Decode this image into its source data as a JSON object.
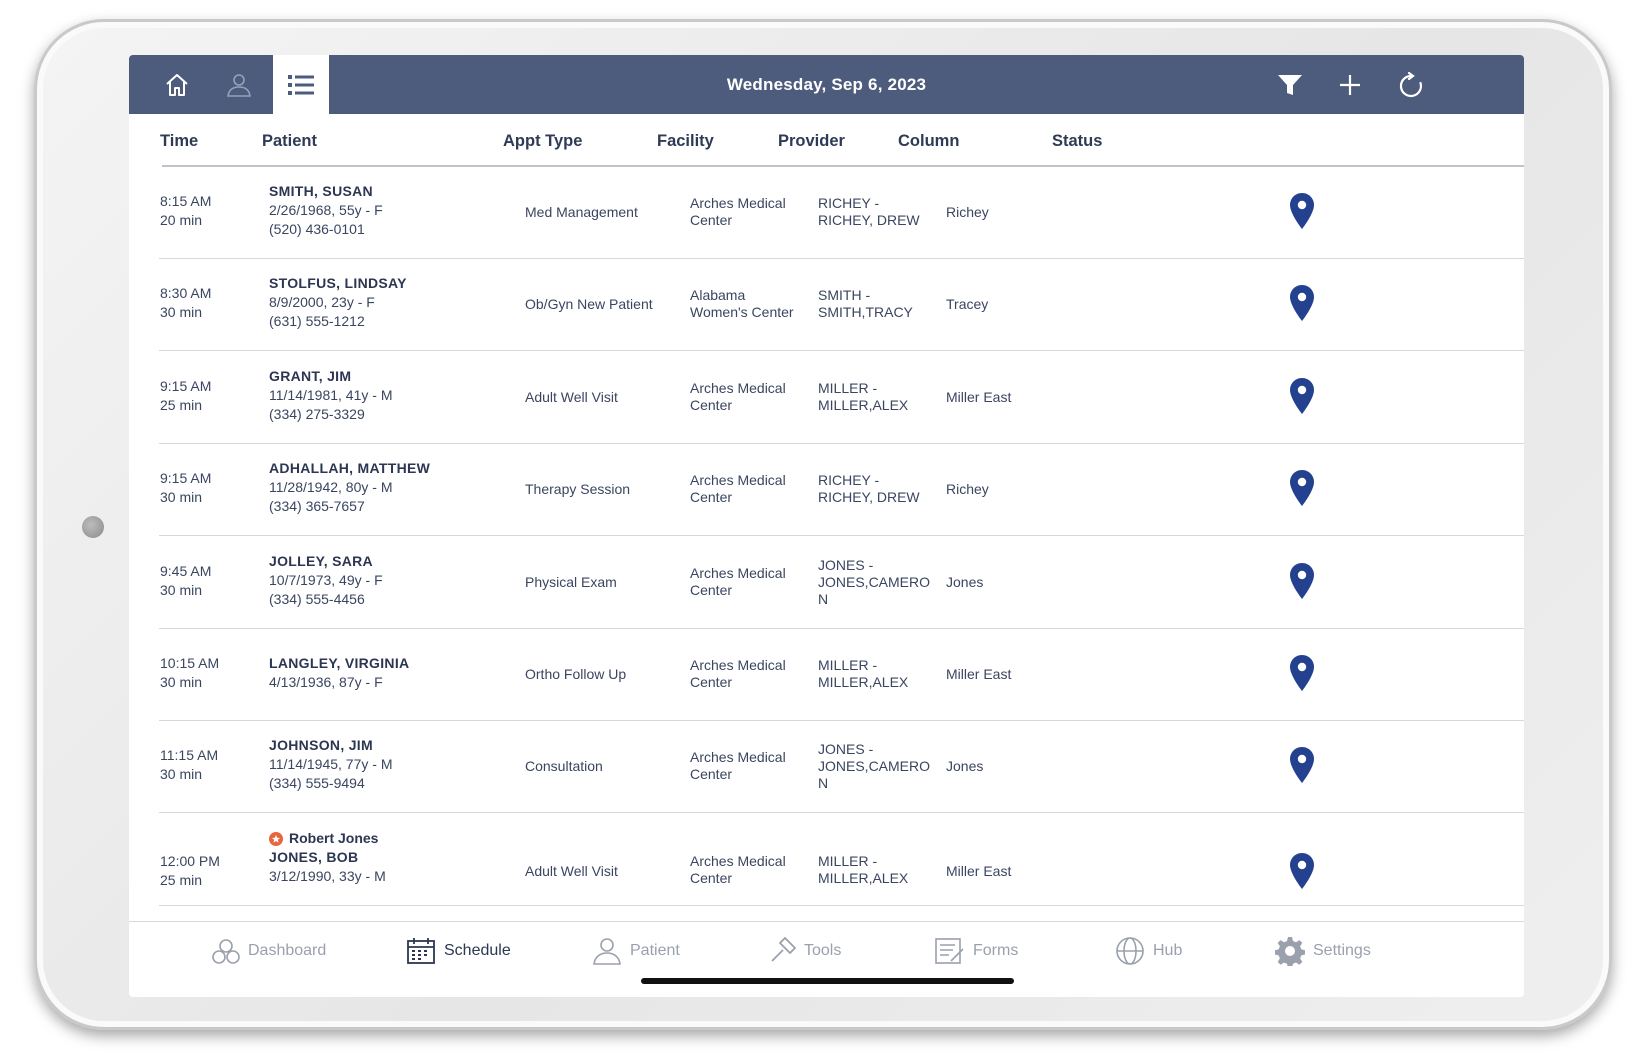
{
  "header": {
    "date": "Wednesday, Sep 6, 2023",
    "nav": [
      {
        "icon": "home-icon"
      },
      {
        "icon": "person-icon"
      },
      {
        "icon": "list-icon",
        "active": true
      }
    ],
    "actions": [
      {
        "icon": "filter-icon"
      },
      {
        "icon": "plus-icon"
      },
      {
        "icon": "refresh-icon"
      }
    ]
  },
  "columns": {
    "time": "Time",
    "patient": "Patient",
    "appt_type": "Appt Type",
    "facility": "Facility",
    "provider": "Provider",
    "column": "Column",
    "status": "Status"
  },
  "appointments": [
    {
      "time": "8:15 AM",
      "duration": "20 min",
      "name": "SMITH, SUSAN",
      "dob": "2/26/1968, 55y - F",
      "phone": "(520) 436-0101",
      "appt_type": "Med Management",
      "facility_1": "Arches Medical",
      "facility_2": "Center",
      "provider_1": "RICHEY -",
      "provider_2": "RICHEY, DREW",
      "column": "Richey"
    },
    {
      "time": "8:30 AM",
      "duration": "30 min",
      "name": "STOLFUS, LINDSAY",
      "dob": "8/9/2000, 23y - F",
      "phone": "(631) 555-1212",
      "appt_type": "Ob/Gyn New Patient",
      "facility_1": "Alabama",
      "facility_2": "Women's Center",
      "provider_1": "SMITH -",
      "provider_2": "SMITH,TRACY",
      "column": "Tracey"
    },
    {
      "time": "9:15 AM",
      "duration": "25 min",
      "name": "GRANT, JIM",
      "dob": "11/14/1981, 41y - M",
      "phone": "(334) 275-3329",
      "appt_type": "Adult Well Visit",
      "facility_1": "Arches Medical",
      "facility_2": "Center",
      "provider_1": "MILLER -",
      "provider_2": "MILLER,ALEX",
      "column": "Miller East"
    },
    {
      "time": "9:15 AM",
      "duration": "30 min",
      "name": "ADHALLAH, MATTHEW",
      "dob": "11/28/1942, 80y - M",
      "phone": "(334) 365-7657",
      "appt_type": "Therapy Session",
      "facility_1": "Arches Medical",
      "facility_2": "Center",
      "provider_1": "RICHEY -",
      "provider_2": "RICHEY, DREW",
      "column": "Richey"
    },
    {
      "time": "9:45 AM",
      "duration": "30 min",
      "name": "JOLLEY, SARA",
      "dob": "10/7/1973, 49y - F",
      "phone": "(334) 555-4456",
      "appt_type": "Physical Exam",
      "facility_1": "Arches Medical",
      "facility_2": "Center",
      "provider_1": "JONES -",
      "provider_2": "JONES,CAMERON",
      "column": "Jones"
    },
    {
      "time": "10:15 AM",
      "duration": "30 min",
      "name": "LANGLEY, VIRGINIA",
      "dob": "4/13/1936, 87y - F",
      "phone": "",
      "appt_type": "Ortho Follow Up",
      "facility_1": "Arches Medical",
      "facility_2": "Center",
      "provider_1": "MILLER -",
      "provider_2": "MILLER,ALEX",
      "column": "Miller East"
    },
    {
      "time": "11:15 AM",
      "duration": "30 min",
      "name": "JOHNSON, JIM",
      "dob": "11/14/1945, 77y - M",
      "phone": "(334) 555-9494",
      "appt_type": "Consultation",
      "facility_1": "Arches Medical",
      "facility_2": "Center",
      "provider_1": "JONES -",
      "provider_2": "JONES,CAMERON",
      "column": "Jones"
    },
    {
      "time": "12:00 PM",
      "duration": "25 min",
      "alias": "Robert Jones",
      "name": "JONES, BOB",
      "dob": "3/12/1990, 33y - M",
      "phone": "",
      "appt_type": "Adult Well Visit",
      "facility_1": "Arches Medical",
      "facility_2": "Center",
      "provider_1": "MILLER -",
      "provider_2": "MILLER,ALEX",
      "column": "Miller East"
    }
  ],
  "tabs": [
    {
      "label": "Dashboard",
      "icon": "dashboard-icon"
    },
    {
      "label": "Schedule",
      "icon": "calendar-icon",
      "active": true
    },
    {
      "label": "Patient",
      "icon": "patient-icon"
    },
    {
      "label": "Tools",
      "icon": "hammer-icon"
    },
    {
      "label": "Forms",
      "icon": "forms-icon"
    },
    {
      "label": "Hub",
      "icon": "globe-icon"
    },
    {
      "label": "Settings",
      "icon": "gear-icon"
    }
  ],
  "colors": {
    "navbar": "#4d5b7d",
    "pin": "#23418f",
    "alias_badge": "#e8663d"
  }
}
